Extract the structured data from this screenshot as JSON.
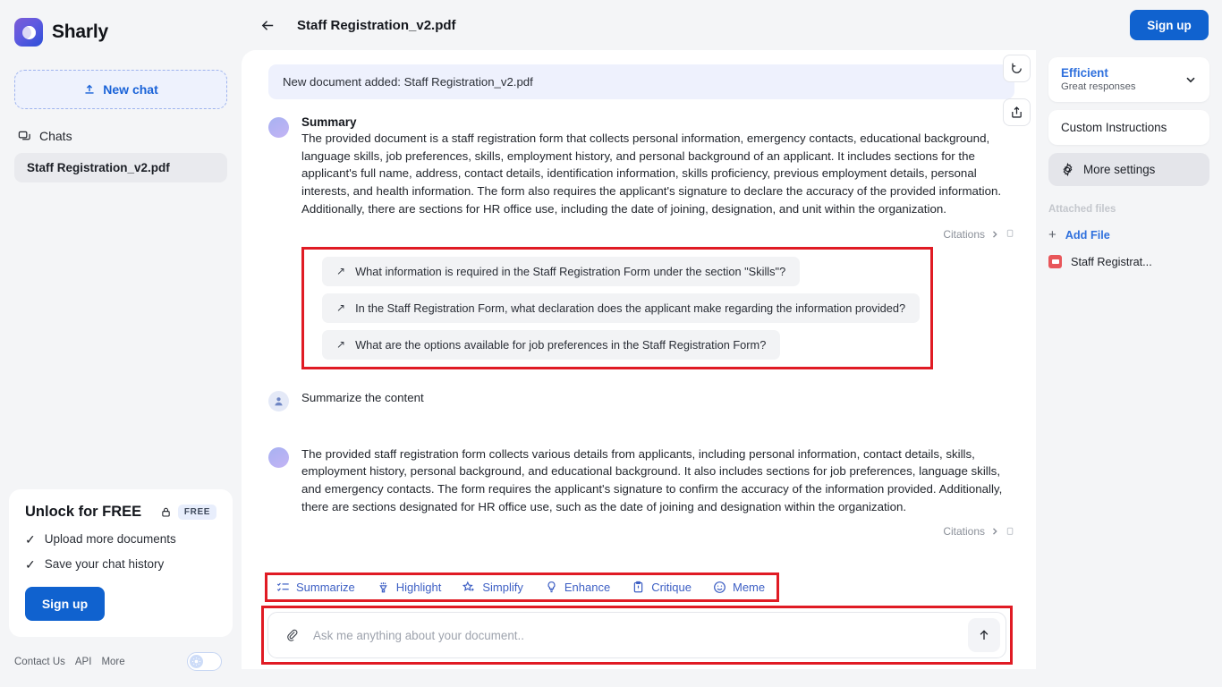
{
  "brand": {
    "name": "Sharly",
    "logo_icon": "sharly-logo-icon"
  },
  "sidebar": {
    "new_chat_label": "New chat",
    "new_chat_icon": "upload-icon",
    "chats_label": "Chats",
    "chats_icon": "chats-icon",
    "chat_items": [
      {
        "label": "Staff Registration_v2.pdf"
      }
    ],
    "promo": {
      "title": "Unlock for FREE",
      "lock_icon": "lock-icon",
      "badge": "FREE",
      "features": [
        "Upload more documents",
        "Save your chat history"
      ],
      "cta_label": "Sign up"
    },
    "footer": {
      "links": [
        "Contact Us",
        "API",
        "More"
      ],
      "theme_toggle_icon": "sun-icon"
    }
  },
  "topbar": {
    "back_icon": "back-arrow-icon",
    "title": "Staff Registration_v2.pdf",
    "signup_label": "Sign up"
  },
  "chat": {
    "system_note": "New document added: Staff Registration_v2.pdf",
    "refresh_icon": "refresh-icon",
    "share_icon": "share-icon",
    "summary_title": "Summary",
    "summary_text": "The provided document is a staff registration form that collects personal information, emergency contacts, educational background, language skills, job preferences, skills, employment history, and personal background of an applicant. It includes sections for the applicant's full name, address, contact details, identification information, skills proficiency, previous employment details, personal interests, and health information. The form also requires the applicant's signature to declare the accuracy of the provided information. Additionally, there are sections for HR office use, including the date of joining, designation, and unit within the organization.",
    "citations_label": "Citations",
    "citations_chevron": "chevron-right-icon",
    "copy_icon": "copy-icon",
    "suggestions": [
      "What information is required in the Staff Registration Form under the section \"Skills\"?",
      "In the Staff Registration Form, what declaration does the applicant make regarding the information provided?",
      "What are the options available for job preferences in the Staff Registration Form?"
    ],
    "suggestion_icon": "arrow-up-right-icon",
    "user_message": "Summarize the content",
    "assistant_reply": "The provided staff registration form collects various details from applicants, including personal information, contact details, skills, employment history, personal background, and educational background. It also includes sections for job preferences, language skills, and emergency contacts. The form requires the applicant's signature to confirm the accuracy of the information provided. Additionally, there are sections designated for HR office use, such as the date of joining and designation within the organization."
  },
  "actions": [
    {
      "label": "Summarize",
      "icon": "summarize-icon"
    },
    {
      "label": "Highlight",
      "icon": "highlighter-icon"
    },
    {
      "label": "Simplify",
      "icon": "sparkle-star-icon"
    },
    {
      "label": "Enhance",
      "icon": "lightbulb-icon"
    },
    {
      "label": "Critique",
      "icon": "clipboard-alert-icon"
    },
    {
      "label": "Meme",
      "icon": "smiley-icon"
    }
  ],
  "composer": {
    "attach_icon": "paperclip-icon",
    "placeholder": "Ask me anything about your document..",
    "value": "",
    "send_icon": "send-arrow-up-icon"
  },
  "right_panel": {
    "mode_title": "Efficient",
    "mode_sub": "Great responses",
    "mode_chevron": "chevron-down-icon",
    "custom_instructions_label": "Custom Instructions",
    "more_settings_label": "More settings",
    "more_settings_icon": "gear-icon",
    "attached_files_label": "Attached files",
    "add_file_label": "Add File",
    "add_file_icon": "plus-icon",
    "files": [
      {
        "name": "Staff Registrat...",
        "icon": "pdf-file-icon"
      }
    ]
  },
  "colors": {
    "accent_blue": "#1062cf",
    "link_blue": "#2f70dd",
    "highlight_red": "#e01b24",
    "panel_bg": "#f4f5f7"
  }
}
